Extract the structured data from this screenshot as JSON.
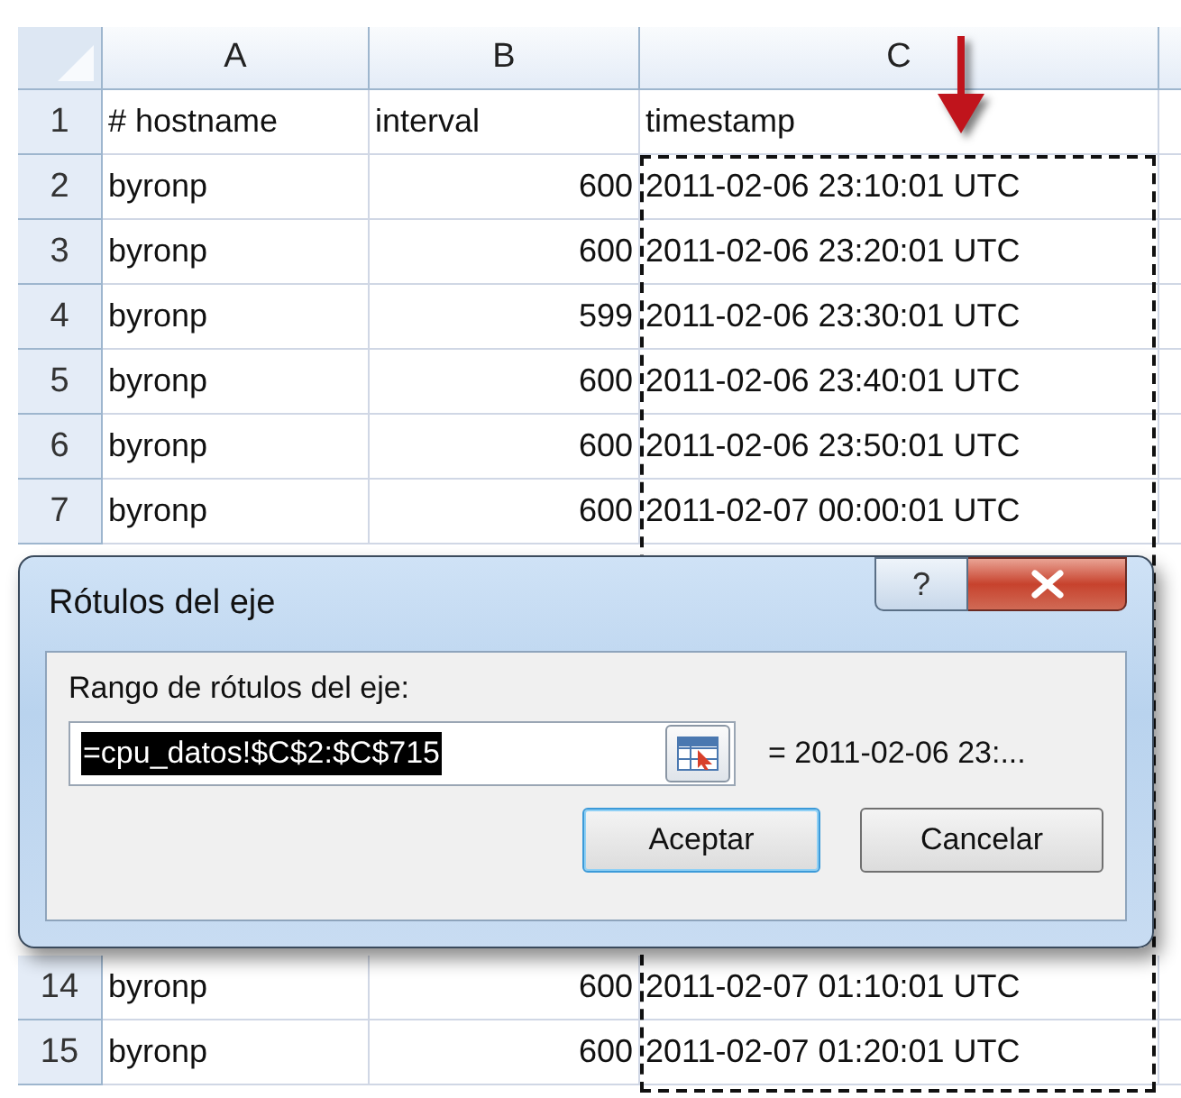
{
  "columns": [
    "A",
    "B",
    "C"
  ],
  "rows": [
    {
      "number": "1",
      "kind": "header",
      "cells": [
        "# hostname",
        "interval",
        "timestamp"
      ]
    },
    {
      "number": "2",
      "kind": "data",
      "cells": [
        "byronp",
        "600",
        "2011-02-06 23:10:01 UTC"
      ]
    },
    {
      "number": "3",
      "kind": "data",
      "cells": [
        "byronp",
        "600",
        "2011-02-06 23:20:01 UTC"
      ]
    },
    {
      "number": "4",
      "kind": "data",
      "cells": [
        "byronp",
        "599",
        "2011-02-06 23:30:01 UTC"
      ]
    },
    {
      "number": "5",
      "kind": "data",
      "cells": [
        "byronp",
        "600",
        "2011-02-06 23:40:01 UTC"
      ]
    },
    {
      "number": "6",
      "kind": "data",
      "cells": [
        "byronp",
        "600",
        "2011-02-06 23:50:01 UTC"
      ]
    },
    {
      "number": "7",
      "kind": "data",
      "cells": [
        "byronp",
        "600",
        "2011-02-07 00:00:01 UTC"
      ]
    }
  ],
  "rows_below": [
    {
      "number": "14",
      "kind": "data",
      "cells": [
        "byronp",
        "600",
        "2011-02-07 01:10:01 UTC"
      ]
    },
    {
      "number": "15",
      "kind": "data",
      "cells": [
        "byronp",
        "600",
        "2011-02-07 01:20:01 UTC"
      ]
    }
  ],
  "dialog": {
    "title": "Rótulos del eje",
    "label": "Rango de rótulos del eje:",
    "value": "=cpu_datos!$C$2:$C$715",
    "preview": "= 2011-02-06 23:...",
    "help": "?",
    "buttons": [
      {
        "label": "Aceptar",
        "default": true
      },
      {
        "label": "Cancelar",
        "default": false
      }
    ]
  }
}
